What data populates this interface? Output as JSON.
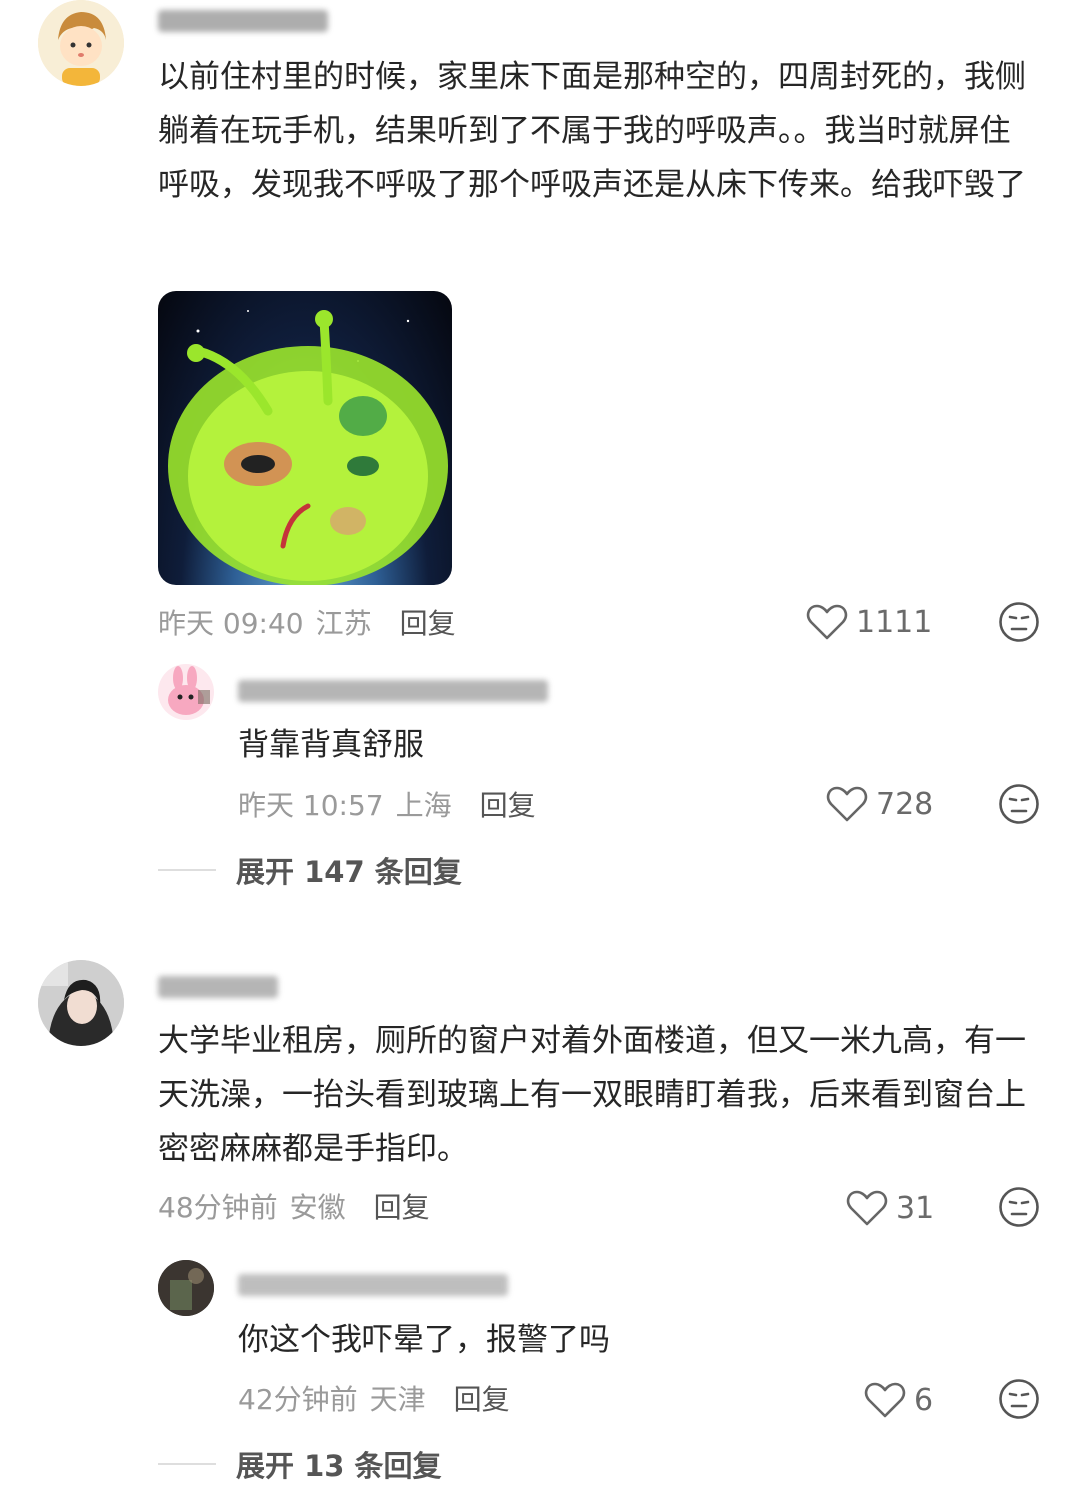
{
  "comments": [
    {
      "text": "以前住村里的时候，家里床下面是那种空的，四周封死的，我侧躺着在玩手机，结果听到了不属于我的呼吸声。。我当时就屏住呼吸，发现我不呼吸了那个呼吸声还是从床下传来。给我吓毁了",
      "time": "昨天 09:40",
      "location": "江苏",
      "reply_label": "回复",
      "likes": "1111",
      "image_icon": "green-alien-cat-sticker",
      "replies": [
        {
          "text": "背靠背真舒服",
          "time": "昨天 10:57",
          "location": "上海",
          "reply_label": "回复",
          "likes": "728"
        }
      ],
      "expand_label": "展开 147 条回复"
    },
    {
      "text": "大学毕业租房，厕所的窗户对着外面楼道，但又一米九高，有一天洗澡，一抬头看到玻璃上有一双眼睛盯着我，后来看到窗台上密密麻麻都是手指印。",
      "time": "48分钟前",
      "location": "安徽",
      "reply_label": "回复",
      "likes": "31",
      "replies": [
        {
          "text": "你这个我吓晕了，报警了吗",
          "time": "42分钟前",
          "location": "天津",
          "reply_label": "回复",
          "likes": "6"
        }
      ],
      "expand_label": "展开 13 条回复"
    }
  ],
  "colors": {
    "text": "#262626",
    "meta": "#9a9a9a",
    "icon": "#555555",
    "divider": "#dedede"
  }
}
